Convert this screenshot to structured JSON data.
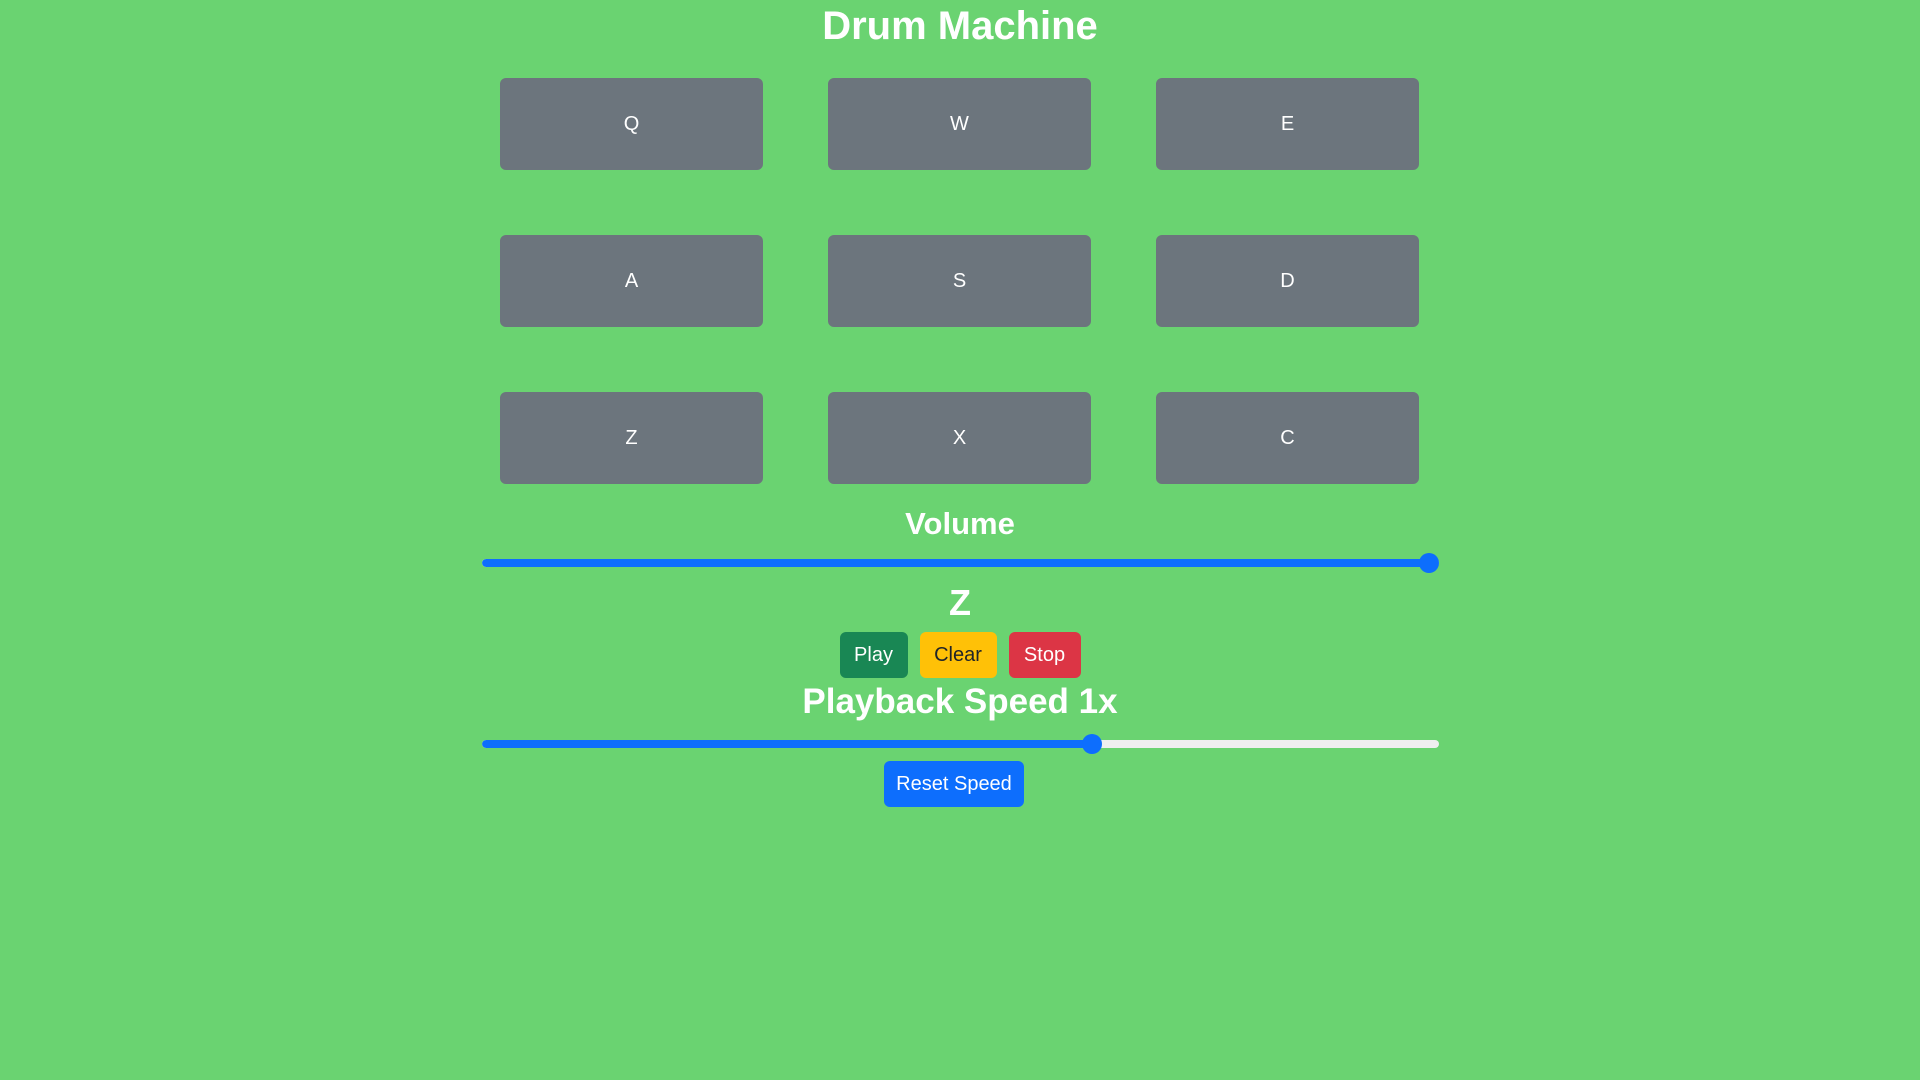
{
  "app": {
    "title": "Drum Machine"
  },
  "pads": [
    {
      "key": "Q"
    },
    {
      "key": "W"
    },
    {
      "key": "E"
    },
    {
      "key": "A"
    },
    {
      "key": "S"
    },
    {
      "key": "D"
    },
    {
      "key": "Z"
    },
    {
      "key": "X"
    },
    {
      "key": "C"
    }
  ],
  "volume": {
    "label": "Volume",
    "value_fraction": 1.0
  },
  "display": {
    "current_key": "Z"
  },
  "controls": {
    "play_label": "Play",
    "clear_label": "Clear",
    "stop_label": "Stop"
  },
  "speed": {
    "label": "Playback Speed 1x",
    "value_fraction": 0.64,
    "reset_label": "Reset Speed"
  },
  "colors": {
    "background": "#6ad371",
    "pad": "#6c757d",
    "accent": "#0d6efd",
    "play": "#198754",
    "clear": "#ffc107",
    "stop": "#dc3545"
  }
}
